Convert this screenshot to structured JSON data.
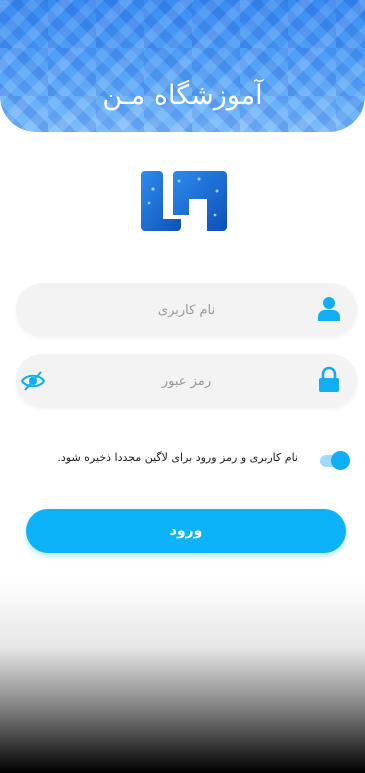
{
  "header": {
    "title": "آموزشگاه مـن"
  },
  "logo": {
    "name": "school-logo-icon",
    "color": "#1e73d9"
  },
  "username_field": {
    "placeholder": "نام کاربری",
    "value": ""
  },
  "password_field": {
    "placeholder": "رمز عبور",
    "value": ""
  },
  "remember": {
    "label": "نام کاربری و رمز ورود برای لاگین مجددا ذخیره شود.",
    "enabled": true
  },
  "login_button": {
    "label": "ورود"
  },
  "colors": {
    "accent": "#0cb3f8",
    "header": "#3a8cf0"
  }
}
